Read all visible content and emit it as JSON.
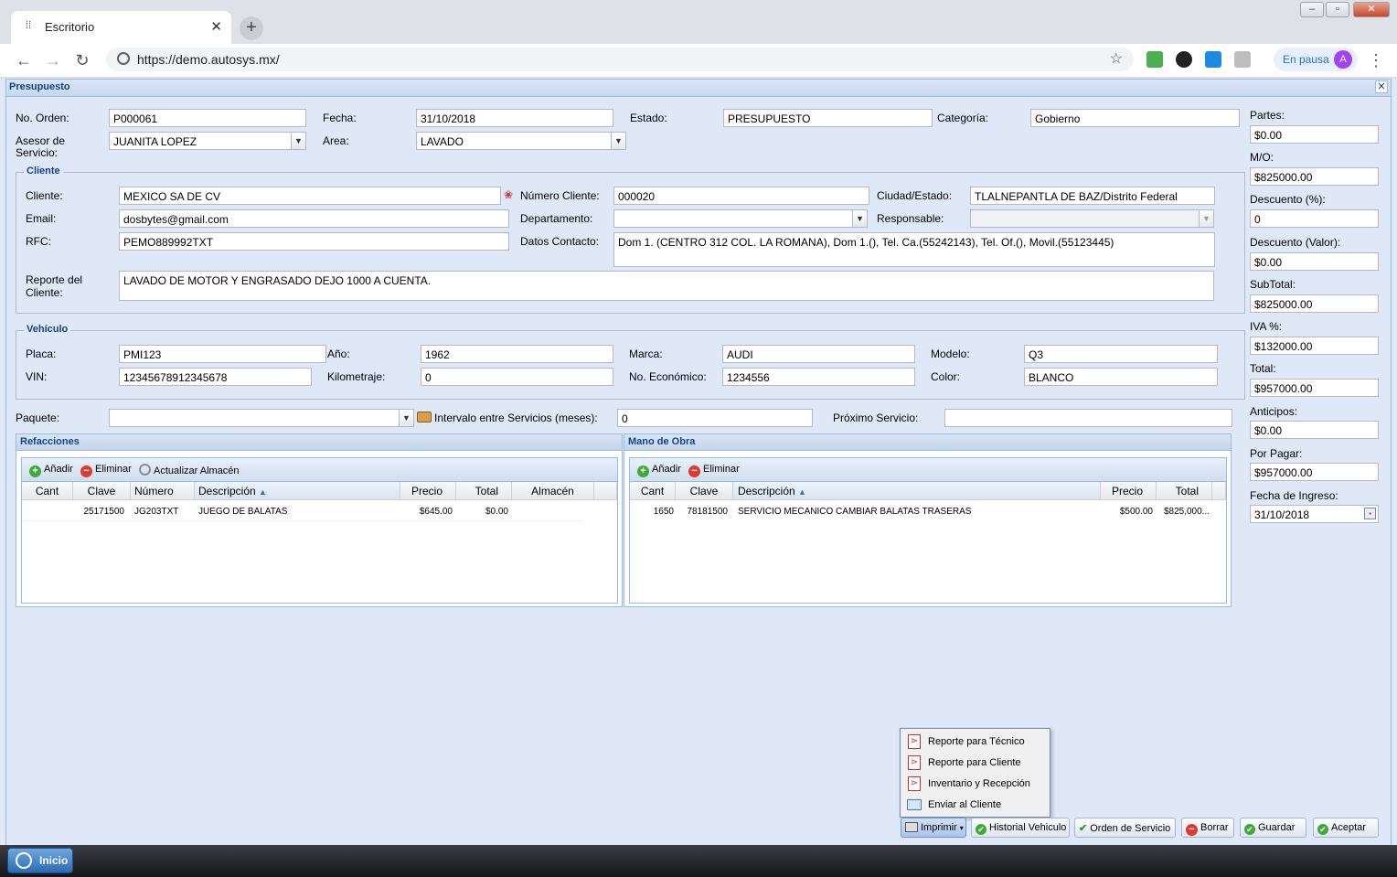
{
  "browser": {
    "tab_title": "Escritorio",
    "url": "https://demo.autosys.mx/",
    "profile_status": "En pausa",
    "profile_initial": "A"
  },
  "window": {
    "title": "Presupuesto"
  },
  "header": {
    "no_orden_label": "No. Orden:",
    "no_orden": "P000061",
    "fecha_label": "Fecha:",
    "fecha": "31/10/2018",
    "estado_label": "Estado:",
    "estado": "PRESUPUESTO",
    "categoria_label": "Categoría:",
    "categoria": "Gobierno",
    "asesor_label_1": "Asesor de",
    "asesor_label_2": "Servicio:",
    "asesor": "JUANITA LOPEZ",
    "area_label": "Area:",
    "area": "LAVADO"
  },
  "cliente": {
    "legend": "Cliente",
    "cliente_label": "Cliente:",
    "cliente": "MEXICO SA DE CV",
    "numero_label": "Número Cliente:",
    "numero": "000020",
    "ciudad_label": "Ciudad/Estado:",
    "ciudad": "TLALNEPANTLA DE BAZ/Distrito Federal",
    "email_label": "Email:",
    "email": "dosbytes@gmail.com",
    "departamento_label": "Departamento:",
    "departamento": "",
    "responsable_label": "Responsable:",
    "responsable": "",
    "rfc_label": "RFC:",
    "rfc": "PEMO889992TXT",
    "datos_label": "Datos Contacto:",
    "datos": "Dom 1. (CENTRO 312 COL. LA ROMANA), Dom 1.(), Tel. Ca.(55242143), Tel. Of.(), Movil.(55123445)",
    "reporte_label_1": "Reporte del",
    "reporte_label_2": "Cliente:",
    "reporte": "LAVADO DE MOTOR Y ENGRASADO DEJO 1000 A CUENTA."
  },
  "vehiculo": {
    "legend": "Vehículo",
    "placa_label": "Placa:",
    "placa": "PMI123",
    "anio_label": "Año:",
    "anio": "1962",
    "marca_label": "Marca:",
    "marca": "AUDI",
    "modelo_label": "Modelo:",
    "modelo": "Q3",
    "vin_label": "VIN:",
    "vin": "12345678912345678",
    "km_label": "Kilometraje:",
    "km": "0",
    "economico_label": "No. Económico:",
    "economico": "1234556",
    "color_label": "Color:",
    "color": "BLANCO"
  },
  "paquete": {
    "paquete_label": "Paquete:",
    "paquete": "",
    "intervalo_label": "Intervalo entre Servicios (meses):",
    "intervalo": "0",
    "proximo_label": "Próximo Servicio:",
    "proximo": ""
  },
  "refacciones": {
    "title": "Refacciones",
    "add": "Añadir",
    "remove": "Eliminar",
    "update": "Actualizar Almacén",
    "columns": [
      "Cant",
      "Clave",
      "Número",
      "Descripción",
      "Precio",
      "Total",
      "Almacén"
    ],
    "rows": [
      {
        "cant": "",
        "clave": "25171500",
        "numero": "JG203TXT",
        "descripcion": "JUEGO DE BALATAS",
        "precio": "$645.00",
        "total": "$0.00",
        "almacen": ""
      }
    ]
  },
  "mano_obra": {
    "title": "Mano de Obra",
    "add": "Añadir",
    "remove": "Eliminar",
    "columns": [
      "Cant",
      "Clave",
      "Descripción",
      "Precio",
      "Total"
    ],
    "rows": [
      {
        "cant": "1650",
        "clave": "78181500",
        "descripcion": "SERVICIO MECANICO CAMBIAR BALATAS TRASERAS",
        "precio": "$500.00",
        "total": "$825,000..."
      }
    ]
  },
  "totals": {
    "partes_label": "Partes:",
    "partes": "$0.00",
    "mo_label": "M/O:",
    "mo": "$825000.00",
    "desc_pct_label": "Descuento (%):",
    "desc_pct": "0",
    "desc_val_label": "Descuento (Valor):",
    "desc_val": "$0.00",
    "subtotal_label": "SubTotal:",
    "subtotal": "$825000.00",
    "iva_label": "IVA %:",
    "iva": "$132000.00",
    "total_label": "Total:",
    "total": "$957000.00",
    "anticipos_label": "Anticipos:",
    "anticipos": "$0.00",
    "por_pagar_label": "Por Pagar:",
    "por_pagar": "$957000.00",
    "fecha_ingreso_label": "Fecha de Ingreso:",
    "fecha_ingreso": "31/10/2018"
  },
  "print_menu": {
    "items": [
      "Reporte para Técnico",
      "Reporte para Cliente",
      "Inventario y Recepción",
      "Enviar al Cliente"
    ]
  },
  "actions": {
    "imprimir": "Imprimir",
    "historial": "Historial Vehiculo",
    "orden": "Orden de Servicio",
    "borrar": "Borrar",
    "guardar": "Guardar",
    "aceptar": "Aceptar"
  },
  "taskbar": {
    "start": "Inicio"
  }
}
